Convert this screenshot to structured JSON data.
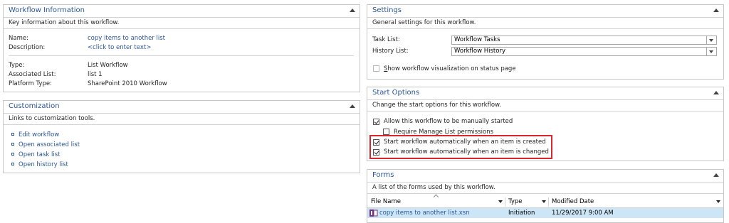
{
  "workflow_info": {
    "title": "Workflow Information",
    "description": "Key information about this workflow.",
    "name_label": "Name:",
    "name_value": "copy items to another list",
    "description_label": "Description:",
    "description_value": "<click to enter text>",
    "type_label": "Type:",
    "type_value": "List Workflow",
    "associated_label": "Associated List:",
    "associated_value": "list 1",
    "platform_label": "Platform Type:",
    "platform_value": "SharePoint 2010 Workflow"
  },
  "customization": {
    "title": "Customization",
    "description": "Links to customization tools.",
    "links": [
      "Edit workflow",
      "Open associated list",
      "Open task list",
      "Open history list"
    ]
  },
  "settings": {
    "title": "Settings",
    "description": "General settings for this workflow.",
    "task_list_label": "Task List:",
    "task_list_value": "Workflow Tasks",
    "history_list_label": "History List:",
    "history_list_value": "Workflow History",
    "visualization_label": "Show workflow visualization on status page"
  },
  "start_options": {
    "title": "Start Options",
    "description": "Change the start options for this workflow.",
    "manual_label": "Allow this workflow to be manually started",
    "manual_checked": true,
    "permissions_label": "Require Manage List permissions",
    "permissions_checked": false,
    "on_create_label": "Start workflow automatically when an item is created",
    "on_create_checked": true,
    "on_change_label": "Start workflow automatically when an item is changed",
    "on_change_checked": true,
    "highlight_color": "#d9262c"
  },
  "forms": {
    "title": "Forms",
    "description": "A list of the forms used by this workflow.",
    "columns": [
      "File Name",
      "Type",
      "Modified Date"
    ],
    "rows": [
      {
        "file": "copy items to another list.xsn",
        "type": "Initiation",
        "modified": "11/29/2017 9:00 AM"
      }
    ],
    "selected_row_color": "#cde6f7"
  },
  "colors": {
    "accent": "#2b579a",
    "border": "#c6c6c6"
  }
}
